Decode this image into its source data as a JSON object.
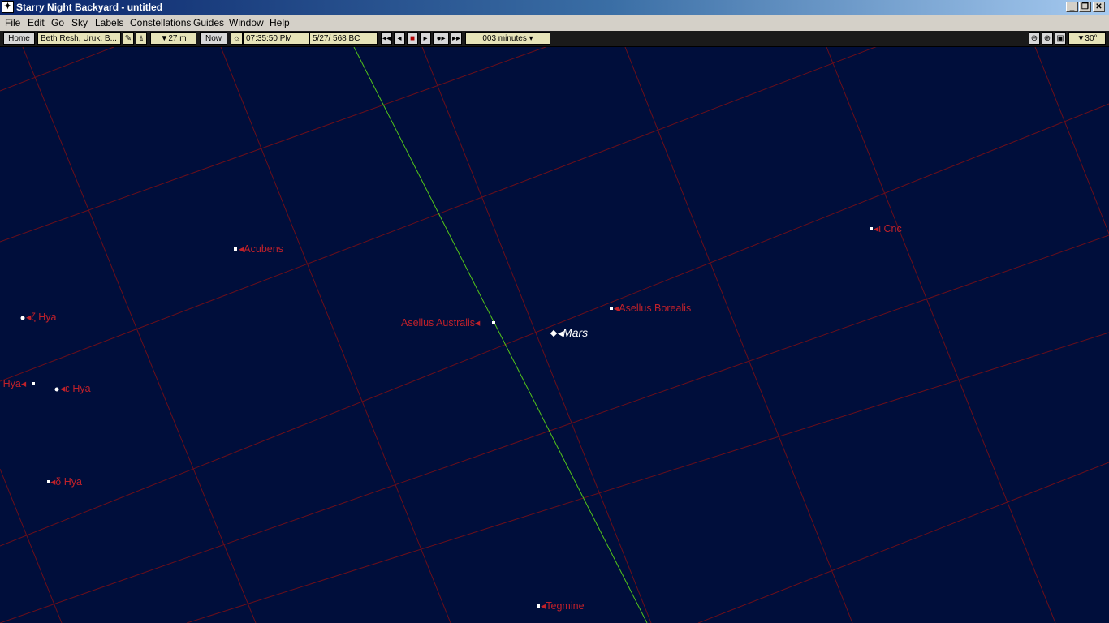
{
  "window": {
    "title": "Starry Night Backyard - untitled",
    "minimize_glyph": "_",
    "restore_glyph": "❐",
    "close_glyph": "✕"
  },
  "menu": [
    "File",
    "Edit",
    "Go",
    "Sky",
    "Labels",
    "Constellations",
    "Guides",
    "Window",
    "Help"
  ],
  "toolbar": {
    "home_label": "Home",
    "location": "Beth Resh, Uruk, B...",
    "elevation": "▼27 m",
    "now_label": "Now",
    "time": "07:35:50 PM",
    "date": "5/27/  568 BC",
    "time_step": "003 minutes",
    "fov": "▼30°"
  },
  "colors": {
    "sky_background": "#000e3b",
    "grid_line": "#6b0e1a",
    "ecliptic_line": "#52c41a",
    "star_label": "#c0212a",
    "planet_label": "#ffffff"
  },
  "sky": {
    "stars": [
      {
        "name": "Acubens"
      },
      {
        "name": "ζ Hya"
      },
      {
        "name": "ρ Hya"
      },
      {
        "name": "ε Hya"
      },
      {
        "name": "δ Hya"
      },
      {
        "name": "Asellus Australis"
      },
      {
        "name": "Asellus Borealis"
      },
      {
        "name": "ι Cnc"
      },
      {
        "name": "Tegmine"
      }
    ],
    "planets": [
      {
        "name": "Mars"
      }
    ]
  }
}
